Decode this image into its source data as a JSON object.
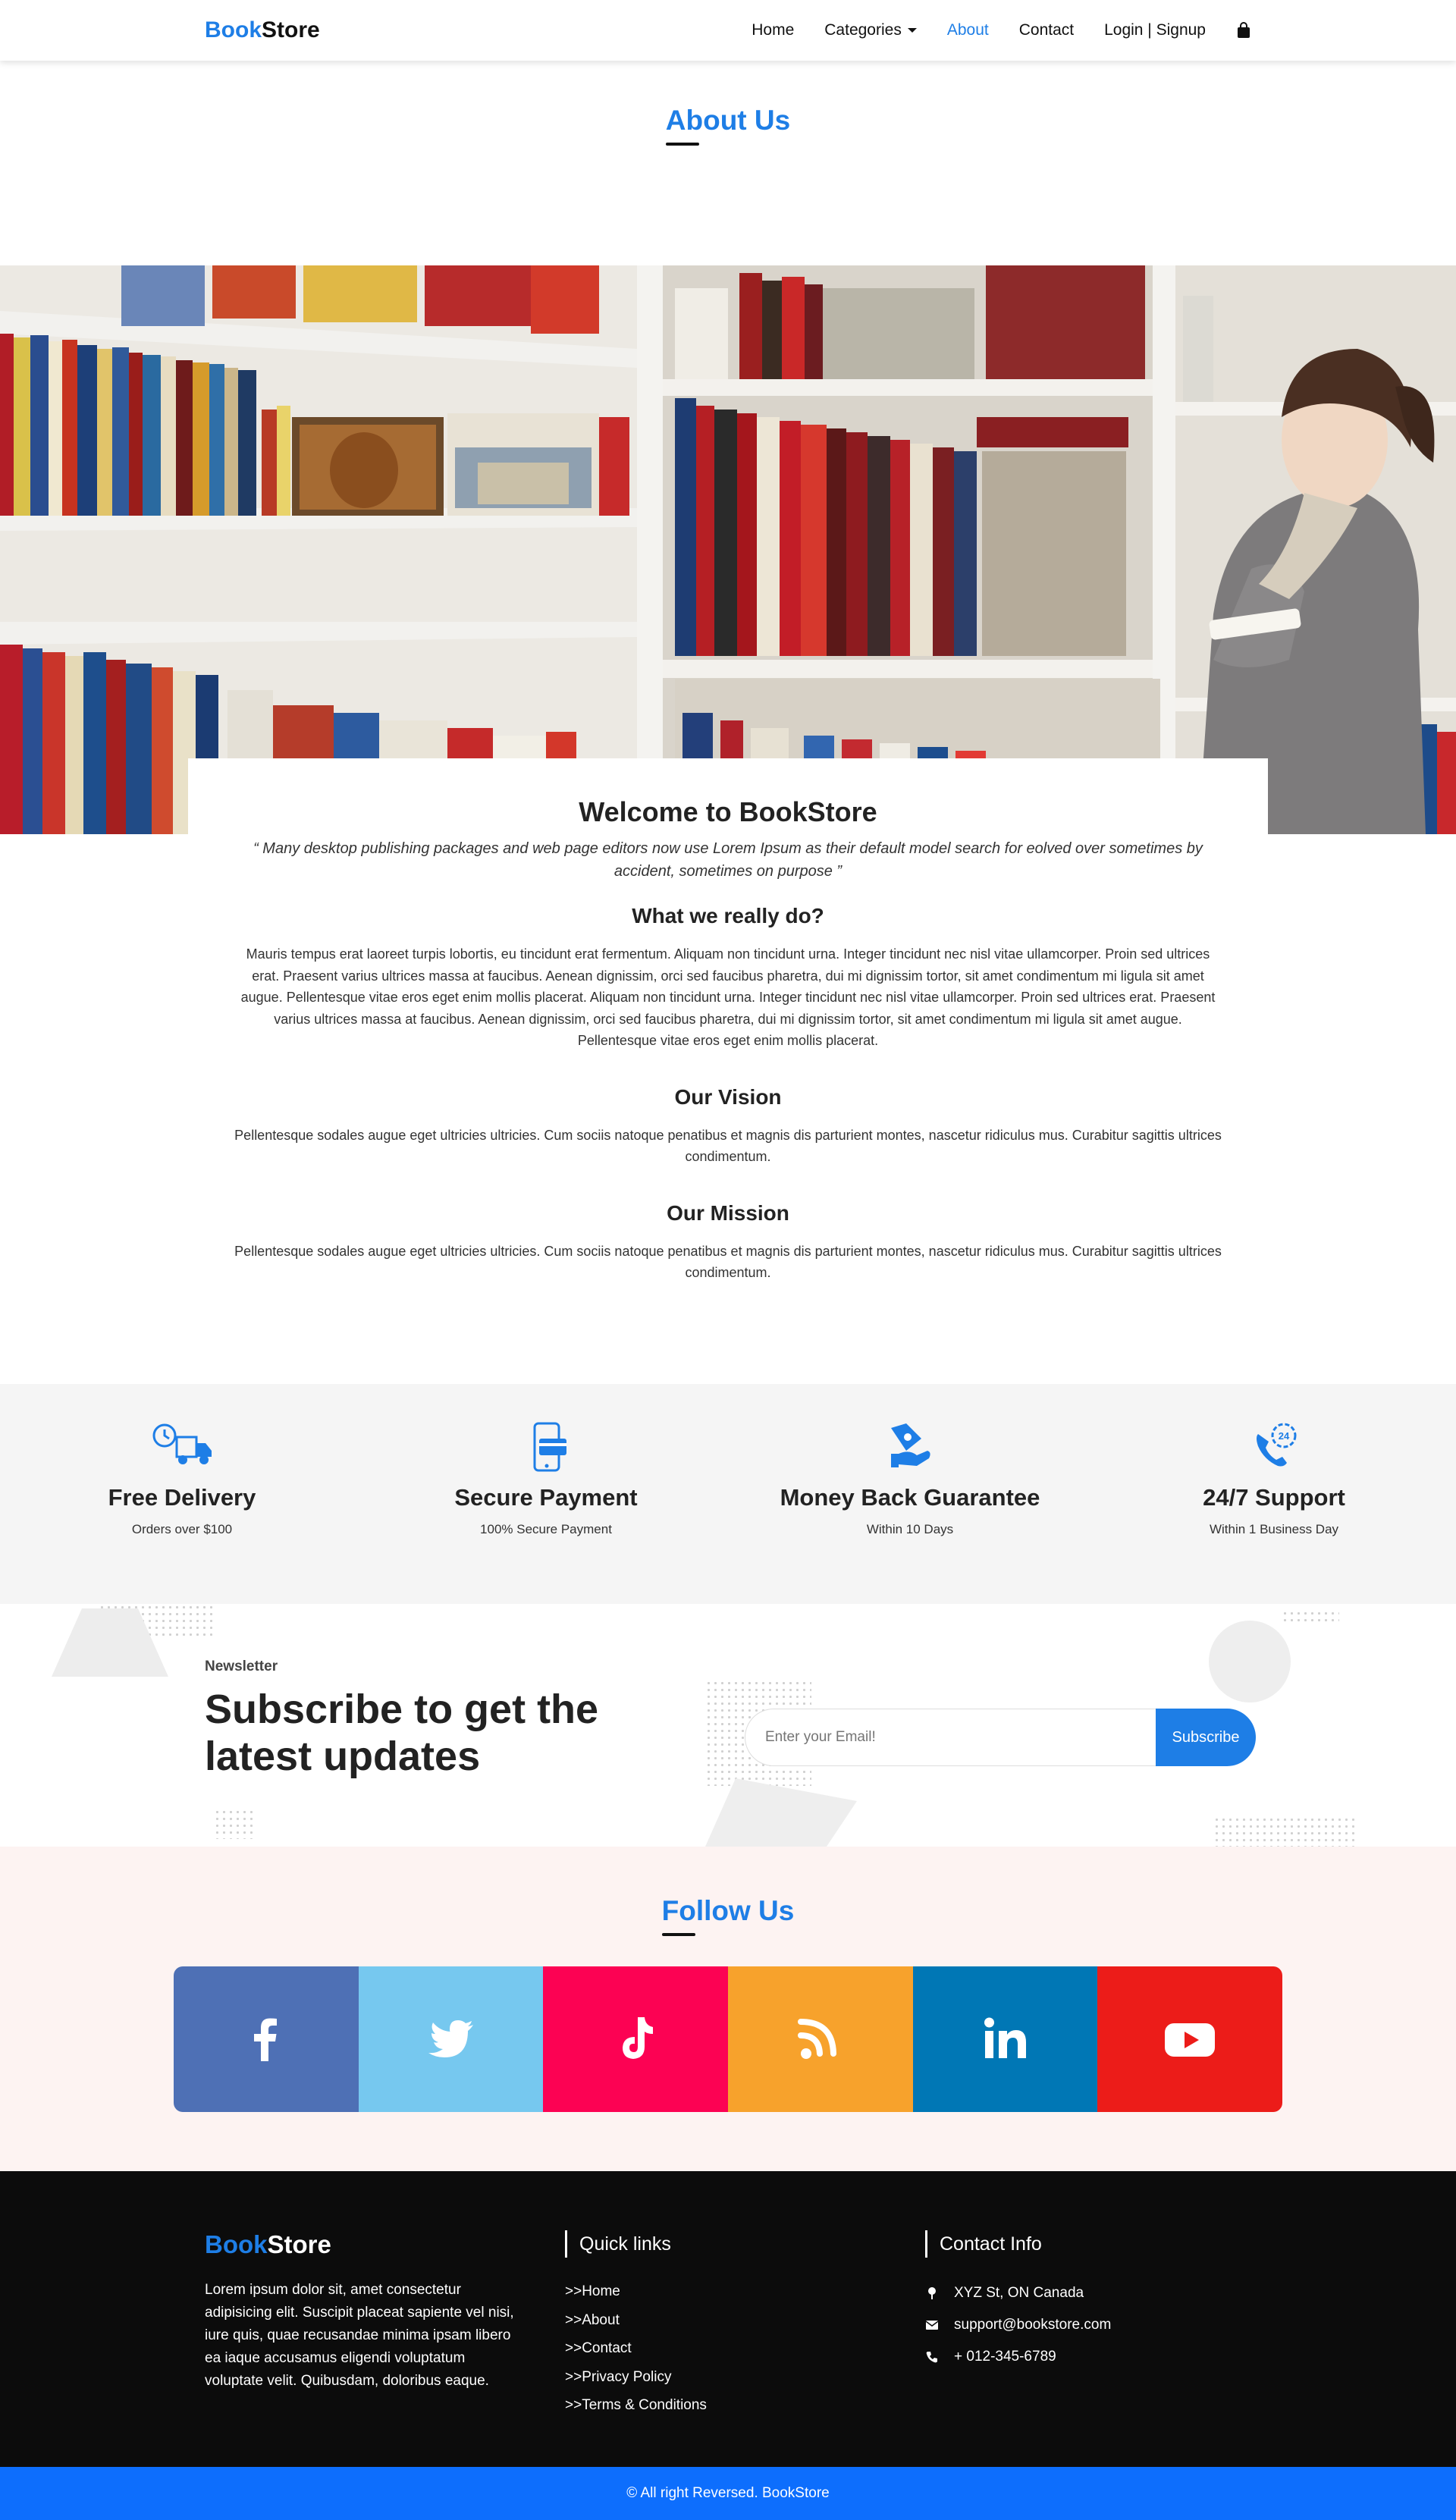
{
  "nav": {
    "brand_accent": "Book",
    "brand_rest": "Store",
    "links": [
      "Home",
      "Categories",
      "About",
      "Contact",
      "Login | Signup"
    ],
    "active": "About",
    "cart_icon": "shopping-bag-icon"
  },
  "about": {
    "title": "About Us"
  },
  "card": {
    "title": "Welcome to BookStore",
    "quote": "“ Many desktop publishing packages and web page editors now use Lorem Ipsum as their default model search for eolved over sometimes by accident, sometimes on purpose ”",
    "sections": [
      {
        "heading": "What we really do?",
        "text": "Mauris tempus erat laoreet turpis lobortis, eu tincidunt erat fermentum. Aliquam non tincidunt urna. Integer tincidunt nec nisl vitae ullamcorper. Proin sed ultrices erat. Praesent varius ultrices massa at faucibus. Aenean dignissim, orci sed faucibus pharetra, dui mi dignissim tortor, sit amet condimentum mi ligula sit amet augue. Pellentesque vitae eros eget enim mollis placerat. Aliquam non tincidunt urna. Integer tincidunt nec nisl vitae ullamcorper. Proin sed ultrices erat. Praesent varius ultrices massa at faucibus. Aenean dignissim, orci sed faucibus pharetra, dui mi dignissim tortor, sit amet condimentum mi ligula sit amet augue. Pellentesque vitae eros eget enim mollis placerat."
      },
      {
        "heading": "Our Vision",
        "text": "Pellentesque sodales augue eget ultricies ultricies. Cum sociis natoque penatibus et magnis dis parturient montes, nascetur ridiculus mus. Curabitur sagittis ultrices condimentum."
      },
      {
        "heading": "Our Mission",
        "text": "Pellentesque sodales augue eget ultricies ultricies. Cum sociis natoque penatibus et magnis dis parturient montes, nascetur ridiculus mus. Curabitur sagittis ultrices condimentum."
      }
    ]
  },
  "features": [
    {
      "title": "Free Delivery",
      "subtitle": "Orders over $100",
      "icon": "delivery-truck-icon"
    },
    {
      "title": "Secure Payment",
      "subtitle": "100% Secure Payment",
      "icon": "mobile-payment-icon"
    },
    {
      "title": "Money Back Guarantee",
      "subtitle": "Within 10 Days",
      "icon": "money-back-icon"
    },
    {
      "title": "24/7 Support",
      "subtitle": "Within 1 Business Day",
      "icon": "support-phone-icon"
    }
  ],
  "newsletter": {
    "tag": "Newsletter",
    "title_line1": "Subscribe to get the",
    "title_line2": "latest updates",
    "placeholder": "Enter your Email!",
    "button": "Subscribe"
  },
  "follow": {
    "title": "Follow Us",
    "networks": [
      {
        "name": "facebook-icon",
        "color": "#4e70b5"
      },
      {
        "name": "twitter-icon",
        "color": "#76c8ef"
      },
      {
        "name": "tiktok-icon",
        "color": "#fc0253"
      },
      {
        "name": "rss-icon",
        "color": "#f7a22c"
      },
      {
        "name": "linkedin-icon",
        "color": "#0077b5"
      },
      {
        "name": "youtube-icon",
        "color": "#ec1c19"
      }
    ]
  },
  "footer": {
    "brand_accent": "Book",
    "brand_rest": "Store",
    "about_text": "Lorem ipsum dolor sit, amet consectetur adipisicing elit. Suscipit placeat sapiente vel nisi, iure quis, quae recusandae minima ipsam libero ea iaque accusamus eligendi voluptatum voluptate velit. Quibusdam, doloribus eaque.",
    "quick_links_title": "Quick links",
    "quick_links": [
      ">>Home",
      ">>About",
      ">>Contact",
      ">>Privacy Policy",
      ">>Terms & Conditions"
    ],
    "contact_title": "Contact Info",
    "address": "XYZ St, ON Canada",
    "email": "support@bookstore.com",
    "phone": "+ 012-345-6789"
  },
  "copyright": "© All right Reversed.  BookStore",
  "colors": {
    "accent": "#1e7ee6",
    "footer_bg": "#0c0c0c",
    "copyright_bg": "#0d6efd",
    "features_bg": "#f5f5f5",
    "follow_bg": "#fdf3f2"
  }
}
